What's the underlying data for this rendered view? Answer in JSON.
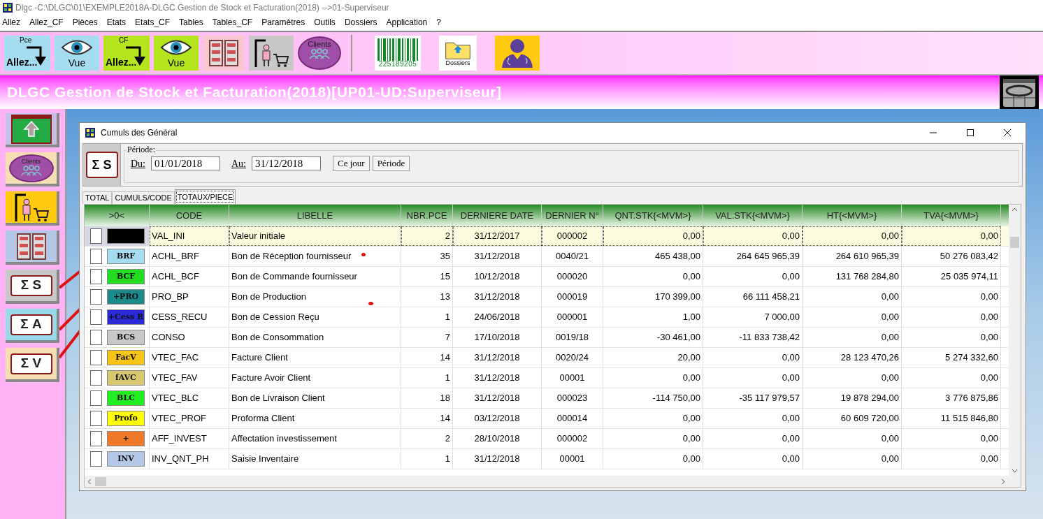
{
  "window": {
    "title": "Dlgc -C:\\DLGC\\01\\EXEMPLE2018A-DLGC Gestion de Stock et Facturation(2018) -->01-Superviseur"
  },
  "menu": [
    "Allez",
    "Allez_CF",
    "Pièces",
    "Etats",
    "Etats_CF",
    "Tables",
    "Tables_CF",
    "Paramètres",
    "Outils",
    "Dossiers",
    "Application",
    "?"
  ],
  "toolbar": [
    {
      "kind": "goto",
      "top": "Pce",
      "label": "Allez...",
      "color": "#a6dcef"
    },
    {
      "kind": "eye",
      "label": "Vue",
      "color": "#a6dcef"
    },
    {
      "kind": "goto",
      "top": "CF",
      "label": "Allez...",
      "color": "#b5e61d"
    },
    {
      "kind": "eye",
      "label": "Vue",
      "color": "#b5e61d"
    },
    {
      "kind": "grid",
      "color": "#f7c6d0"
    },
    {
      "kind": "cart",
      "color": "#c8c8c8"
    },
    {
      "kind": "clients",
      "label": "Clients",
      "color": "#a04fa8"
    },
    {
      "kind": "sep"
    },
    {
      "kind": "barcode",
      "label": "225189205",
      "color": "#ffffff"
    },
    {
      "kind": "folder",
      "label": "Dossiers",
      "color": "#ffffff"
    },
    {
      "kind": "doctor",
      "color": "#ffc90e"
    }
  ],
  "banner": {
    "title": "DLGC Gestion de Stock et Facturation(2018)[UP01-UD:Superviseur]"
  },
  "sidebar": [
    {
      "kind": "up",
      "color": "#c8bfe7"
    },
    {
      "kind": "clients",
      "label": "Clients",
      "color": "#f5deb3"
    },
    {
      "kind": "cart",
      "color": "#ffc90e"
    },
    {
      "kind": "grid",
      "color": "#b4c7e7"
    },
    {
      "kind": "sigma",
      "label": "Σ S",
      "color": "#c8c8c8"
    },
    {
      "kind": "sigma",
      "label": "Σ A",
      "color": "#99d9ea"
    },
    {
      "kind": "sigma",
      "label": "Σ V",
      "color": "#f5deb3"
    }
  ],
  "dialog": {
    "title": "Cumuls des Général",
    "sigma_label": "Σ S",
    "period_label": "Période:",
    "from_label": "Du:",
    "from": "01/01/2018",
    "to_label": "Au:",
    "to": "31/12/2018",
    "buttons": [
      "Ce jour",
      "Période"
    ]
  },
  "tabs": [
    {
      "label": "TOTAL",
      "selected": false
    },
    {
      "label": "CUMULS/CODE",
      "selected": false
    },
    {
      "label": "TOTAUX/PIECE",
      "selected": true
    }
  ],
  "table": {
    "columns": [
      ">0<",
      "CODE",
      "LIBELLE",
      "NBR.PCE",
      "DERNIERE DATE",
      "DERNIER N°",
      "QNT.STK{<MVM>}",
      "VAL.STK{<MVM>}",
      "HT{<MVM>}",
      "TVA{<MVM>}"
    ],
    "rows": [
      {
        "selected": true,
        "checked": false,
        "color": "#000000",
        "cells": [
          "",
          "VAL_INI",
          "Valeur initiale",
          "2",
          "31/12/2017",
          "000002",
          "0,00",
          "0,00",
          "0,00",
          "0,00"
        ]
      },
      {
        "selected": false,
        "checked": false,
        "color": "#a6dcef",
        "cells": [
          "BRF",
          "ACHL_BRF",
          "Bon de Réception fournisseur",
          "35",
          "31/12/2018",
          "0040/21",
          "465 438,00",
          "264 645 965,39",
          "264 610 965,39",
          "50 276 083,42"
        ]
      },
      {
        "selected": false,
        "checked": false,
        "color": "#22dd22",
        "cells": [
          "BCF",
          "ACHL_BCF",
          "Bon de Commande fournisseur",
          "15",
          "10/12/2018",
          "000020",
          "0,00",
          "0,00",
          "131 768 284,80",
          "25 035 974,11"
        ]
      },
      {
        "selected": false,
        "checked": false,
        "color": "#1a8a8a",
        "cells": [
          "+PRO",
          "PRO_BP",
          "Bon de Production",
          "13",
          "31/12/2018",
          "000019",
          "170 399,00",
          "66 111 458,21",
          "0,00",
          "0,00"
        ]
      },
      {
        "selected": false,
        "checked": false,
        "color": "#2a2ad8",
        "cells": [
          "+Cess R",
          "CESS_RECU",
          "Bon de Cession Reçu",
          "1",
          "24/06/2018",
          "000001",
          "1,00",
          "7 000,00",
          "0,00",
          "0,00"
        ]
      },
      {
        "selected": false,
        "checked": false,
        "color": "#c8c8c8",
        "cells": [
          "BCS",
          "CONSO",
          "Bon de Consommation",
          "7",
          "17/10/2018",
          "0019/18",
          "-30 461,00",
          "-11 833 738,42",
          "0,00",
          "0,00"
        ]
      },
      {
        "selected": false,
        "checked": false,
        "color": "#f5c518",
        "cells": [
          "FacV",
          "VTEC_FAC",
          "Facture Client",
          "14",
          "31/12/2018",
          "0020/24",
          "20,00",
          "0,00",
          "28 123 470,26",
          "5 274 332,60"
        ]
      },
      {
        "selected": false,
        "checked": false,
        "color": "#d8c870",
        "cells": [
          "fAVC",
          "VTEC_FAV",
          "Facture Avoir Client",
          "1",
          "31/12/2018",
          "00001",
          "0,00",
          "0,00",
          "0,00",
          "0,00"
        ]
      },
      {
        "selected": false,
        "checked": false,
        "color": "#22ee22",
        "cells": [
          "BLC",
          "VTEC_BLC",
          "Bon de Livraison Client",
          "18",
          "31/12/2018",
          "000023",
          "-114 750,00",
          "-35 117 979,57",
          "19 878 294,00",
          "3 776 875,86"
        ]
      },
      {
        "selected": false,
        "checked": false,
        "color": "#ffff00",
        "cells": [
          "Profo",
          "VTEC_PROF",
          "Proforma Client",
          "14",
          "03/12/2018",
          "000014",
          "0,00",
          "0,00",
          "60 609 720,00",
          "11 515 846,80"
        ]
      },
      {
        "selected": false,
        "checked": false,
        "color": "#f0782a",
        "cells": [
          "+",
          "AFF_INVEST",
          "Affectation investissement",
          "2",
          "28/10/2018",
          "000002",
          "0,00",
          "0,00",
          "0,00",
          "0,00"
        ]
      },
      {
        "selected": false,
        "checked": false,
        "color": "#b4c7e7",
        "cells": [
          "INV",
          "INV_QNT_PH",
          "Saisie Inventaire",
          "1",
          "31/12/2018",
          "00001",
          "0,00",
          "0,00",
          "0,00",
          "0,00"
        ]
      }
    ]
  }
}
